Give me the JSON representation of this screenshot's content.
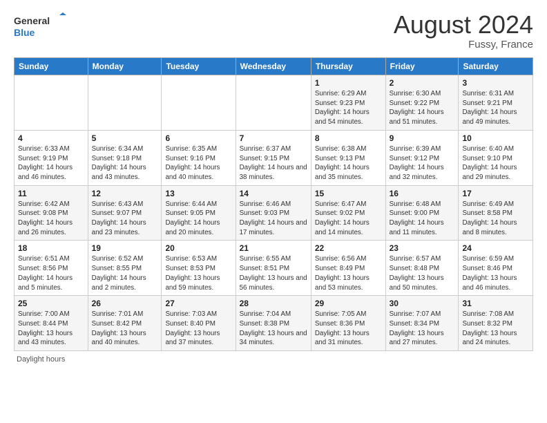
{
  "logo": {
    "line1": "General",
    "line2": "Blue"
  },
  "title": "August 2024",
  "location": "Fussy, France",
  "days_of_week": [
    "Sunday",
    "Monday",
    "Tuesday",
    "Wednesday",
    "Thursday",
    "Friday",
    "Saturday"
  ],
  "footer": "Daylight hours",
  "weeks": [
    [
      {
        "day": "",
        "info": ""
      },
      {
        "day": "",
        "info": ""
      },
      {
        "day": "",
        "info": ""
      },
      {
        "day": "",
        "info": ""
      },
      {
        "day": "1",
        "info": "Sunrise: 6:29 AM\nSunset: 9:23 PM\nDaylight: 14 hours and 54 minutes."
      },
      {
        "day": "2",
        "info": "Sunrise: 6:30 AM\nSunset: 9:22 PM\nDaylight: 14 hours and 51 minutes."
      },
      {
        "day": "3",
        "info": "Sunrise: 6:31 AM\nSunset: 9:21 PM\nDaylight: 14 hours and 49 minutes."
      }
    ],
    [
      {
        "day": "4",
        "info": "Sunrise: 6:33 AM\nSunset: 9:19 PM\nDaylight: 14 hours and 46 minutes."
      },
      {
        "day": "5",
        "info": "Sunrise: 6:34 AM\nSunset: 9:18 PM\nDaylight: 14 hours and 43 minutes."
      },
      {
        "day": "6",
        "info": "Sunrise: 6:35 AM\nSunset: 9:16 PM\nDaylight: 14 hours and 40 minutes."
      },
      {
        "day": "7",
        "info": "Sunrise: 6:37 AM\nSunset: 9:15 PM\nDaylight: 14 hours and 38 minutes."
      },
      {
        "day": "8",
        "info": "Sunrise: 6:38 AM\nSunset: 9:13 PM\nDaylight: 14 hours and 35 minutes."
      },
      {
        "day": "9",
        "info": "Sunrise: 6:39 AM\nSunset: 9:12 PM\nDaylight: 14 hours and 32 minutes."
      },
      {
        "day": "10",
        "info": "Sunrise: 6:40 AM\nSunset: 9:10 PM\nDaylight: 14 hours and 29 minutes."
      }
    ],
    [
      {
        "day": "11",
        "info": "Sunrise: 6:42 AM\nSunset: 9:08 PM\nDaylight: 14 hours and 26 minutes."
      },
      {
        "day": "12",
        "info": "Sunrise: 6:43 AM\nSunset: 9:07 PM\nDaylight: 14 hours and 23 minutes."
      },
      {
        "day": "13",
        "info": "Sunrise: 6:44 AM\nSunset: 9:05 PM\nDaylight: 14 hours and 20 minutes."
      },
      {
        "day": "14",
        "info": "Sunrise: 6:46 AM\nSunset: 9:03 PM\nDaylight: 14 hours and 17 minutes."
      },
      {
        "day": "15",
        "info": "Sunrise: 6:47 AM\nSunset: 9:02 PM\nDaylight: 14 hours and 14 minutes."
      },
      {
        "day": "16",
        "info": "Sunrise: 6:48 AM\nSunset: 9:00 PM\nDaylight: 14 hours and 11 minutes."
      },
      {
        "day": "17",
        "info": "Sunrise: 6:49 AM\nSunset: 8:58 PM\nDaylight: 14 hours and 8 minutes."
      }
    ],
    [
      {
        "day": "18",
        "info": "Sunrise: 6:51 AM\nSunset: 8:56 PM\nDaylight: 14 hours and 5 minutes."
      },
      {
        "day": "19",
        "info": "Sunrise: 6:52 AM\nSunset: 8:55 PM\nDaylight: 14 hours and 2 minutes."
      },
      {
        "day": "20",
        "info": "Sunrise: 6:53 AM\nSunset: 8:53 PM\nDaylight: 13 hours and 59 minutes."
      },
      {
        "day": "21",
        "info": "Sunrise: 6:55 AM\nSunset: 8:51 PM\nDaylight: 13 hours and 56 minutes."
      },
      {
        "day": "22",
        "info": "Sunrise: 6:56 AM\nSunset: 8:49 PM\nDaylight: 13 hours and 53 minutes."
      },
      {
        "day": "23",
        "info": "Sunrise: 6:57 AM\nSunset: 8:48 PM\nDaylight: 13 hours and 50 minutes."
      },
      {
        "day": "24",
        "info": "Sunrise: 6:59 AM\nSunset: 8:46 PM\nDaylight: 13 hours and 46 minutes."
      }
    ],
    [
      {
        "day": "25",
        "info": "Sunrise: 7:00 AM\nSunset: 8:44 PM\nDaylight: 13 hours and 43 minutes."
      },
      {
        "day": "26",
        "info": "Sunrise: 7:01 AM\nSunset: 8:42 PM\nDaylight: 13 hours and 40 minutes."
      },
      {
        "day": "27",
        "info": "Sunrise: 7:03 AM\nSunset: 8:40 PM\nDaylight: 13 hours and 37 minutes."
      },
      {
        "day": "28",
        "info": "Sunrise: 7:04 AM\nSunset: 8:38 PM\nDaylight: 13 hours and 34 minutes."
      },
      {
        "day": "29",
        "info": "Sunrise: 7:05 AM\nSunset: 8:36 PM\nDaylight: 13 hours and 31 minutes."
      },
      {
        "day": "30",
        "info": "Sunrise: 7:07 AM\nSunset: 8:34 PM\nDaylight: 13 hours and 27 minutes."
      },
      {
        "day": "31",
        "info": "Sunrise: 7:08 AM\nSunset: 8:32 PM\nDaylight: 13 hours and 24 minutes."
      }
    ]
  ]
}
